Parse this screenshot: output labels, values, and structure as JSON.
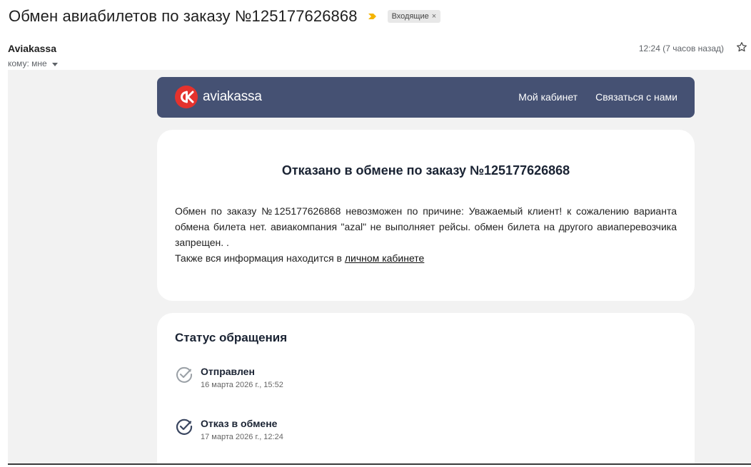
{
  "email": {
    "subject": "Обмен авиабилетов по заказу №125177626868",
    "label": "Входящие",
    "label_remove": "×",
    "sender": "Aviakassa",
    "recipient": "кому: мне",
    "time": "12:24 (7 часов назад)",
    "importance_color": "#f4b400"
  },
  "header": {
    "brand": "aviakassa",
    "logo_mark": "ak",
    "brand_color": "#e5322d",
    "bg_color": "#455173",
    "nav": [
      "Мой кабинет",
      "Связаться с нами"
    ]
  },
  "notice": {
    "title": "Отказано в обмене по заказу №125177626868",
    "body": "Обмен по заказу №125177626868 невозможен по причине: Уважаемый клиент! к сожалению варианта обмена билета нет. авиакомпания \"azal\" не выполняет рейсы. обмен билета на другого авиаперевозчика запрещен. .",
    "info_prefix": "Также вся информация находится в",
    "info_link": "личном кабинете"
  },
  "status": {
    "title": "Статус обращения",
    "items": [
      {
        "label": "Отправлен",
        "date": "16 марта 2026 г., 15:52",
        "icon": "check-circle-icon",
        "active": false
      },
      {
        "label": "Отказ в обмене",
        "date": "17 марта 2026 г., 12:24",
        "icon": "check-circle-icon",
        "active": true
      }
    ]
  }
}
